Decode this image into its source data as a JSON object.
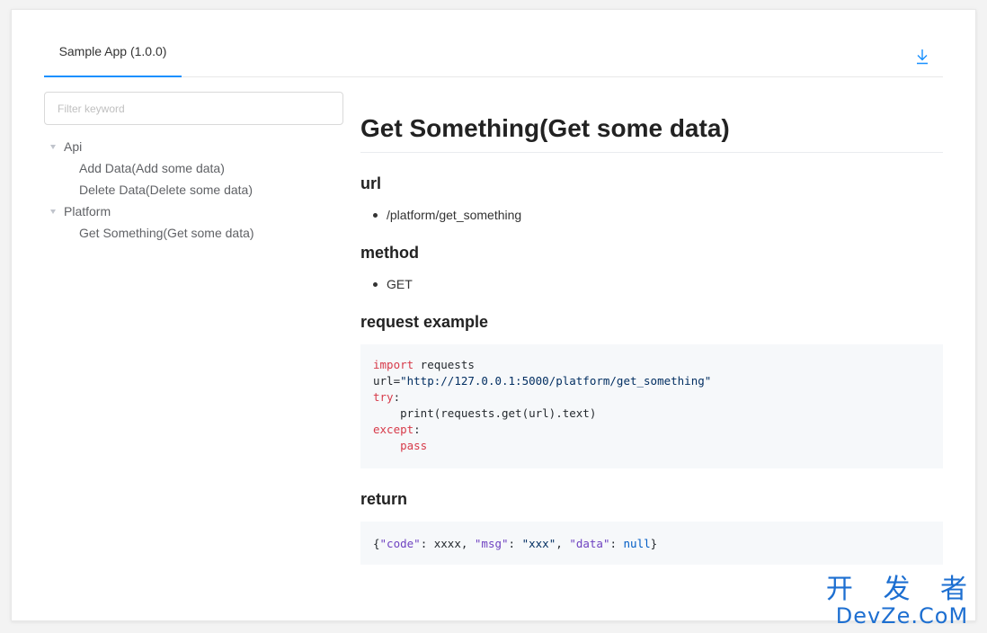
{
  "tab": {
    "label": "Sample App (1.0.0)"
  },
  "sidebar": {
    "filter_placeholder": "Filter keyword",
    "groups": [
      {
        "label": "Api",
        "items": [
          "Add Data(Add some data)",
          "Delete Data(Delete some data)"
        ]
      },
      {
        "label": "Platform",
        "items": [
          "Get Something(Get some data)"
        ]
      }
    ]
  },
  "content": {
    "title": "Get Something(Get some data)",
    "url_heading": "url",
    "url_value": "/platform/get_something",
    "method_heading": "method",
    "method_value": "GET",
    "request_heading": "request example",
    "request_code": {
      "kw_import": "import",
      "module": " requests",
      "url_assign": "url=",
      "url_string": "\"http://127.0.0.1:5000/platform/get_something\"",
      "kw_try": "try",
      "colon": ":",
      "print_line": "    print(requests.get(url).text)",
      "kw_except": "except",
      "colon2": ":",
      "pass_line": "    pass"
    },
    "return_heading": "return",
    "return_code": {
      "open": "{",
      "k_code": "\"code\"",
      "sep1": ": xxxx, ",
      "k_msg": "\"msg\"",
      "sep2": ": ",
      "v_msg": "\"xxx\"",
      "comma": ", ",
      "k_data": "\"data\"",
      "sep3": ": ",
      "v_data": "null",
      "close": "}"
    }
  },
  "watermark": {
    "line1": "开 发 者",
    "line2": "DevZe.CoM"
  },
  "icons": {
    "download": "download-icon",
    "caret": "caret-down-icon"
  },
  "colors": {
    "accent": "#1890ff",
    "keyword": "#d73a49",
    "string": "#032f62",
    "key": "#6f42c1",
    "literal": "#005cc5"
  }
}
